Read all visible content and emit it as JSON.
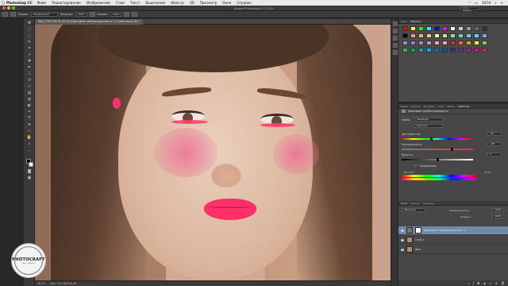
{
  "menubar": {
    "app": "Photoshop CC",
    "items": [
      "Файл",
      "Редактирование",
      "Изображение",
      "Слои",
      "Текст",
      "Выделение",
      "Фильтр",
      "3D",
      "Просмотр",
      "Окно",
      "Справка"
    ],
    "time": "18:54"
  },
  "window": {
    "title": "Adobe Photoshop CC 2015",
    "workspace": "Фото-редакт"
  },
  "options": {
    "mode_label": "Режим:",
    "mode_value": "Нормальный",
    "opacity_label": "Непрозр.:",
    "opacity_value": "100%",
    "flow_label": "Нажим:",
    "flow_value": "100%"
  },
  "document": {
    "tab": "IMG_7728.CR2 @ 16,7% (Цветовой тон/Насыщенность 1, Слой-маска/16) *",
    "zoom": "16,7%",
    "doc_info": "Док: 114,2M/228,4M"
  },
  "swatches_panel": {
    "tabs": [
      "Цвет",
      "Образцы"
    ],
    "colors": [
      "#ff0000",
      "#ffff00",
      "#00ff00",
      "#00ffff",
      "#0000ff",
      "#ff00ff",
      "#ffffff",
      "#cccccc",
      "#999999",
      "#666666",
      "#333333",
      "#000000",
      "#f7977a",
      "#f9ad81",
      "#fdc68a",
      "#fff79a",
      "#c4df9b",
      "#a3d39c",
      "#82ca9d",
      "#7bcdc8",
      "#6ecff6",
      "#7ea7d8",
      "#8493ca",
      "#8882be",
      "#a187be",
      "#bc8dbf",
      "#f49ac2",
      "#f6989d",
      "#ed1c24",
      "#f26522",
      "#f7941d",
      "#fff200",
      "#8dc73f",
      "#39b54a",
      "#00a651",
      "#00a99d",
      "#00aeef",
      "#0072bc",
      "#0054a6",
      "#2e3192",
      "#662d91",
      "#92278f",
      "#ec008c",
      "#ed145b"
    ]
  },
  "properties_panel": {
    "tabs": [
      "Инфо",
      "Каналы",
      "Контуры",
      "Слои",
      "Абзац",
      "Свойства"
    ],
    "title": "Цветовой тон/Насыщенность",
    "preset_label": "Набор:",
    "preset_value": "Заказная",
    "channel_value": "Красные",
    "hue_label": "Цветовой тон:",
    "hue_value": "-35",
    "saturation_label": "Насыщенность:",
    "saturation_value": "+38",
    "lightness_label": "Яркость:",
    "lightness_value": "0",
    "colorize_label": "Тонирование",
    "range_left": "315°/345°",
    "range_right": "4°\\34°"
  },
  "layers_panel": {
    "tabs": [
      "Слои",
      "Каналы",
      "Контуры"
    ],
    "kind_label": "Обычные",
    "opacity_label": "Непрозрачность:",
    "opacity_value": "100%",
    "fill_label": "Заливка:",
    "fill_value": "100%",
    "layers": [
      {
        "name": "Цветовой тон/Насыщенность 1",
        "selected": true
      },
      {
        "name": "Слой 1",
        "selected": false
      },
      {
        "name": "Фон",
        "selected": false
      }
    ]
  },
  "logo": {
    "text": "PHOTOCRAFT",
    "subtext": "PHOTOCRAFT.RU"
  }
}
